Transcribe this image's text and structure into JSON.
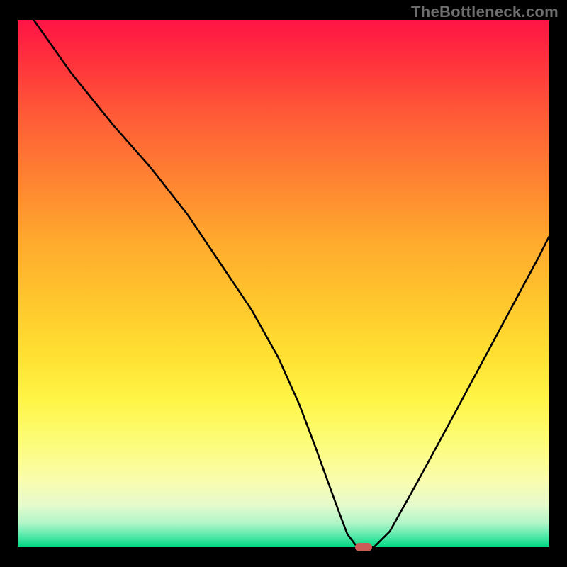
{
  "watermark": "TheBottleneck.com",
  "colors": {
    "curve": "#000000",
    "marker": "#cc5a56",
    "background": "#000000"
  },
  "chart_data": {
    "type": "line",
    "title": "",
    "xlabel": "",
    "ylabel": "",
    "xlim": [
      0,
      100
    ],
    "ylim": [
      0,
      100
    ],
    "grid": false,
    "legend": false,
    "series": [
      {
        "name": "bottleneck-curve",
        "x": [
          3,
          10,
          18,
          25,
          32,
          38,
          44,
          49,
          53,
          56,
          58.5,
          60.5,
          62,
          63.5,
          64.5,
          67,
          70,
          75,
          82,
          90,
          98,
          100
        ],
        "y": [
          100,
          90,
          80,
          72,
          63,
          54,
          45,
          36,
          27,
          19,
          12,
          6.5,
          2.5,
          0.5,
          0,
          0,
          3,
          12,
          25,
          40,
          55,
          59
        ]
      }
    ],
    "marker": {
      "x": 65,
      "y": 0,
      "width_pct": 3.2,
      "height_pct": 1.6
    }
  }
}
